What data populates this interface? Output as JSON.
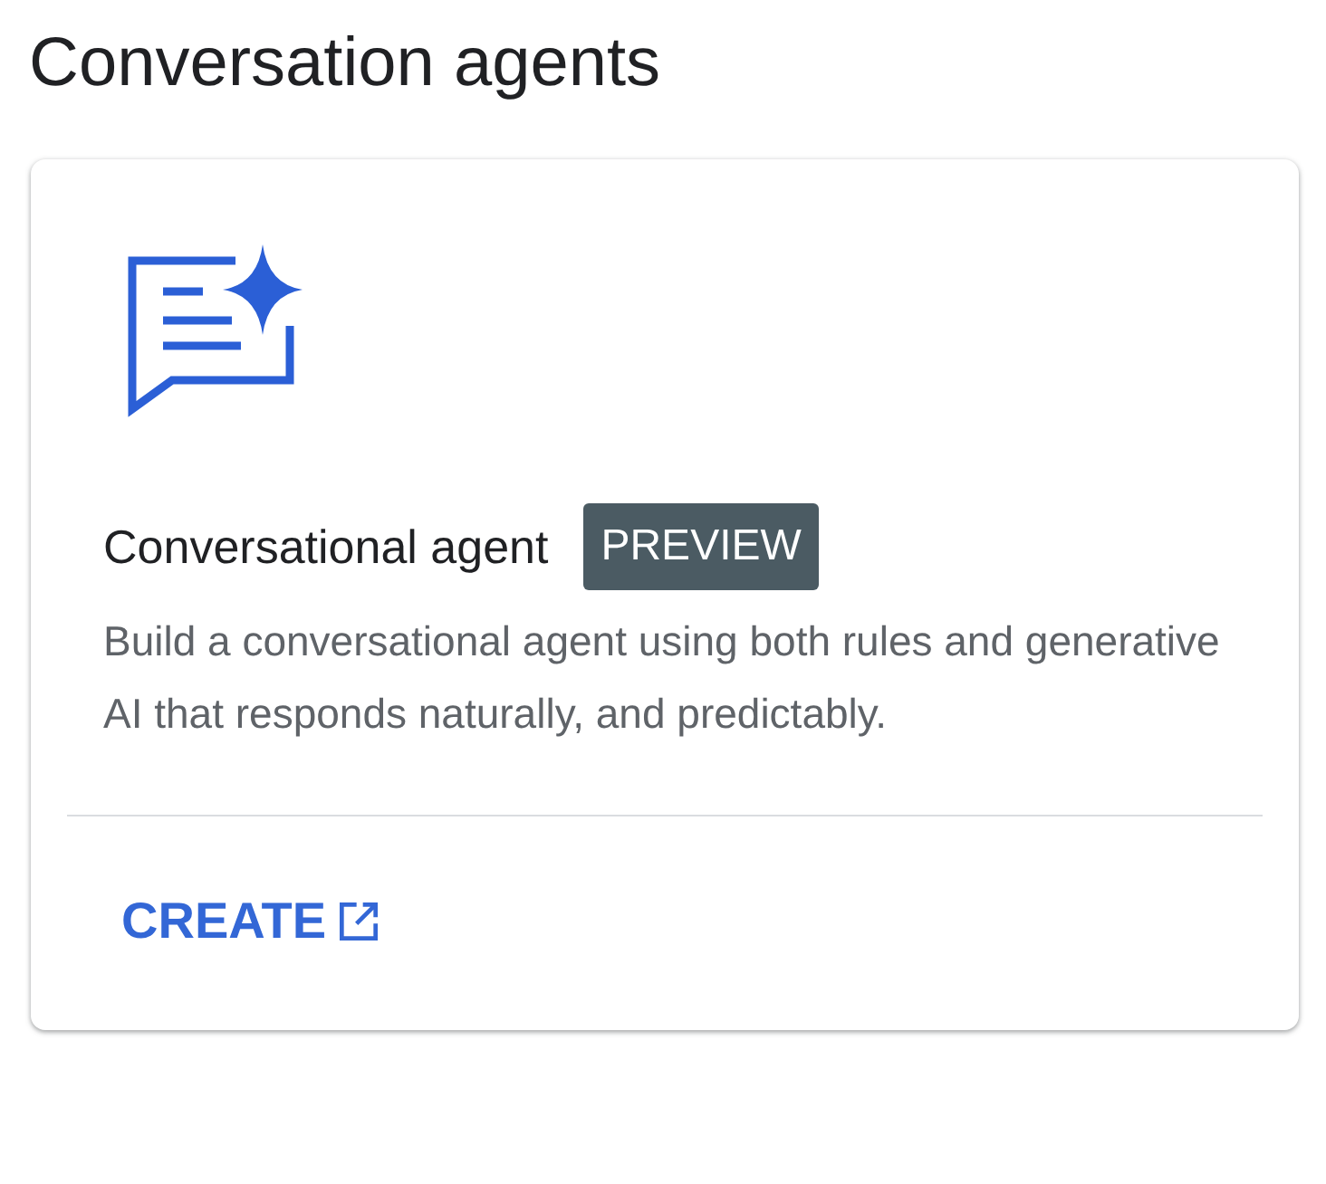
{
  "heading": "Conversation agents",
  "card": {
    "title": "Conversational agent",
    "badge": "PREVIEW",
    "description": "Build a conversational agent using both rules and generative AI that responds naturally, and predictably.",
    "action": "CREATE"
  }
}
